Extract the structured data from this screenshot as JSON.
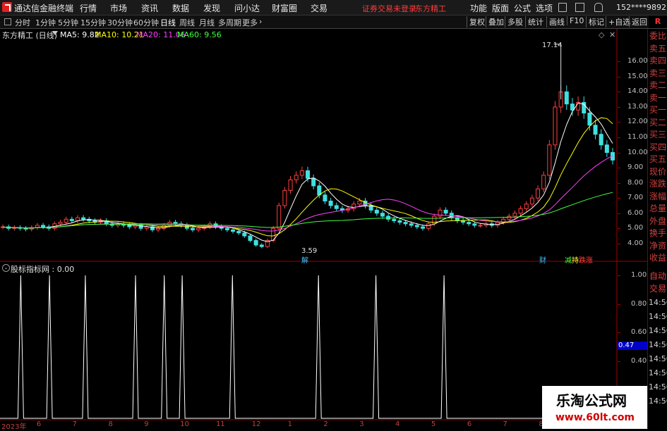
{
  "titlebar": {
    "app_name": "通达信金融终端",
    "menu": [
      "行情",
      "市场",
      "资讯",
      "数据",
      "发现",
      "问小达",
      "财富圈",
      "交易"
    ],
    "trade_notice": "证券交易未登录",
    "stock_name": "东方精工",
    "right_menu": [
      "功能",
      "版面",
      "公式",
      "选项"
    ],
    "account": "152****9892",
    "window_buttons": [
      "—",
      "□",
      "✕"
    ]
  },
  "toolbar": {
    "periods": [
      "分时",
      "1分钟",
      "5分钟",
      "15分钟",
      "30分钟",
      "60分钟",
      "日线",
      "周线",
      "月线",
      "多周期",
      "更多"
    ],
    "active_period": "日线",
    "more_arrow": "›",
    "right_tools": [
      "复权",
      "叠加",
      "多股",
      "统计",
      "画线",
      "F10",
      "标记",
      "+自选",
      "返回"
    ],
    "r_badge": "R"
  },
  "main_chart": {
    "title": "东方精工 (日线)",
    "ma": [
      {
        "label": "MA5: 9.82",
        "color": "#ffffff"
      },
      {
        "label": "MA10: 10.21",
        "color": "#ffff00"
      },
      {
        "label": "MA20: 11.06",
        "color": "#ff40ff"
      },
      {
        "label": "MA60: 9.56",
        "color": "#40ff40"
      }
    ],
    "high_label": "17.14",
    "low_label": "3.59",
    "events": [
      {
        "text": "解",
        "color": "#40c0ff"
      },
      {
        "text": "财",
        "color": "#40c0ff"
      },
      {
        "text": "减",
        "color": "#40ff40"
      },
      {
        "text": "持",
        "color": "#ffff40"
      },
      {
        "text": "跌",
        "color": "#ff4040"
      },
      {
        "text": "涨",
        "color": "#ff4040"
      }
    ]
  },
  "chart_data": [
    {
      "type": "candlestick",
      "title": "东方精工 (日线)",
      "ylim": [
        3.2,
        17.5
      ],
      "yticks": [
        "16.00",
        "15.00",
        "14.00",
        "13.00",
        "12.00",
        "11.00",
        "10.00",
        "9.00",
        "8.00",
        "7.00",
        "6.00",
        "5.00",
        "4.00"
      ],
      "xticks": [
        "2023年",
        "6",
        "7",
        "8",
        "9",
        "10",
        "11",
        "12",
        "1",
        "2",
        "3",
        "4",
        "5",
        "6",
        "7",
        "8",
        "9",
        "10"
      ],
      "price_series": [
        5.1,
        5.0,
        5.05,
        5.0,
        4.95,
        5.05,
        5.2,
        5.1,
        5.0,
        5.3,
        5.4,
        5.6,
        5.5,
        5.7,
        5.6,
        5.5,
        5.4,
        5.5,
        5.3,
        5.2,
        5.3,
        5.2,
        5.1,
        5.2,
        5.0,
        5.1,
        4.9,
        5.0,
        5.2,
        5.4,
        5.3,
        5.2,
        5.0,
        4.9,
        5.0,
        5.1,
        5.3,
        5.1,
        5.0,
        4.9,
        4.8,
        4.7,
        4.5,
        4.2,
        3.9,
        3.8,
        4.2,
        5.0,
        6.5,
        7.5,
        8.2,
        8.5,
        8.8,
        8.3,
        7.8,
        7.2,
        6.8,
        6.5,
        6.3,
        6.2,
        6.3,
        6.6,
        6.8,
        6.5,
        6.2,
        6.0,
        5.8,
        5.6,
        5.5,
        5.4,
        5.3,
        5.2,
        5.1,
        5.0,
        5.3,
        5.8,
        6.2,
        6.0,
        5.7,
        5.5,
        5.4,
        5.3,
        5.2,
        5.2,
        5.3,
        5.2,
        5.4,
        5.6,
        5.8,
        6.0,
        6.3,
        6.6,
        7.0,
        7.6,
        8.5,
        10.5,
        13.0,
        14.0,
        13.2,
        12.8,
        13.3,
        12.6,
        11.8,
        11.2,
        10.5,
        10.0,
        9.5
      ],
      "series": [
        {
          "name": "MA5",
          "value": "9.82",
          "color": "#ffffff"
        },
        {
          "name": "MA10",
          "value": "10.21",
          "color": "#ffff00"
        },
        {
          "name": "MA20",
          "value": "11.06",
          "color": "#ff40ff"
        },
        {
          "name": "MA60",
          "value": "9.56",
          "color": "#40ff40"
        }
      ],
      "annotations": [
        "17.14",
        "3.59"
      ]
    },
    {
      "type": "line",
      "title": "股标指标网",
      "value": "0.00",
      "ylim": [
        0,
        1
      ],
      "yticks": [
        "1.00",
        "0.80",
        "0.60",
        "0.40",
        "0.20"
      ],
      "cursor_value": "0.47",
      "spikes_at_month_index": [
        0.5,
        1.3,
        2.3,
        3.7,
        4.5,
        5.0,
        6.4,
        8.8,
        10.4,
        12.3
      ]
    }
  ],
  "side_panel": {
    "items": [
      "委比",
      "卖五",
      "卖四",
      "卖三",
      "卖二",
      "卖一",
      "买一",
      "买二",
      "买三",
      "买四",
      "买五",
      "现价",
      "涨跌",
      "涨幅",
      "总量",
      "外盘",
      "换手",
      "净资",
      "收益"
    ],
    "auto": "自动",
    "trade": "交易",
    "times": [
      "14:56",
      "14:56",
      "14:56",
      "14:56",
      "14:56",
      "14:56",
      "14:56",
      "14:56"
    ]
  },
  "indicator": {
    "title": "股标指标网 : 0.00"
  },
  "watermark": {
    "line1": "乐淘公式网",
    "line2": "www.60lt.com"
  }
}
